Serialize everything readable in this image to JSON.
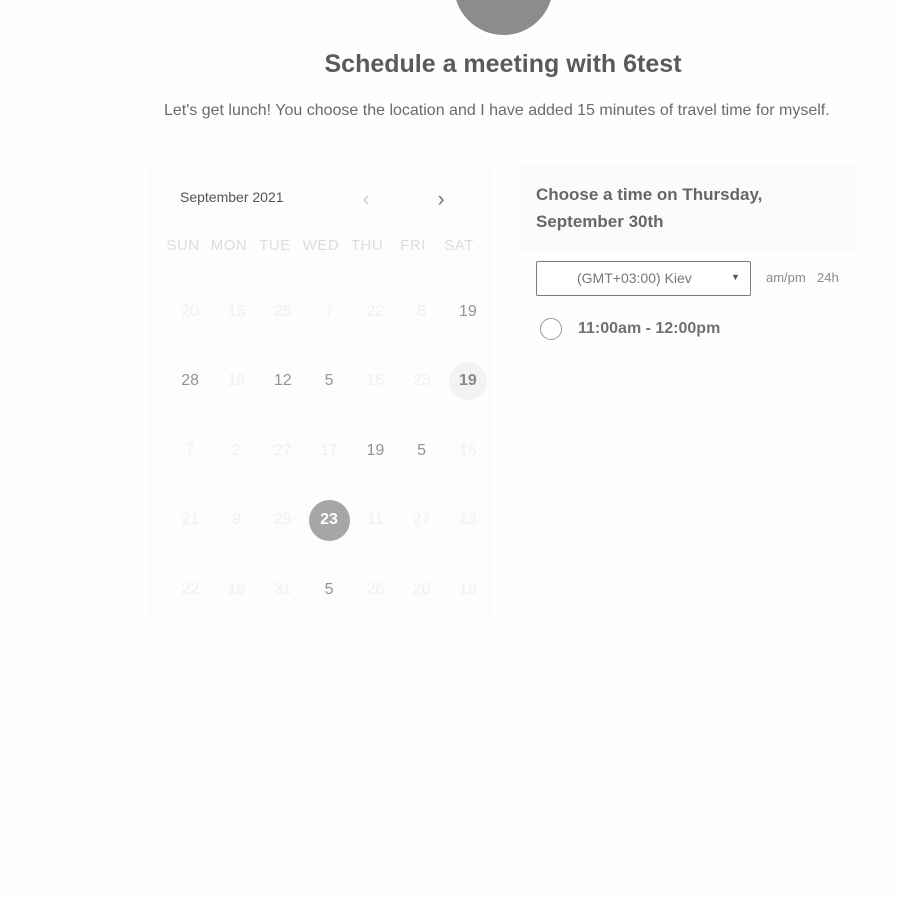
{
  "header": {
    "title": "Schedule a meeting with 6test",
    "description": "Let's get lunch! You choose the location and I have added 15 minutes of travel time for myself."
  },
  "calendar": {
    "month_label": "September 2021",
    "prev_icon": "chevron-left-icon",
    "next_icon": "chevron-right-icon",
    "weekdays": [
      "SUN",
      "MON",
      "TUE",
      "WED",
      "THU",
      "FRI",
      "SAT"
    ],
    "days": [
      {
        "label": "20",
        "state": "faded"
      },
      {
        "label": "15",
        "state": "faded"
      },
      {
        "label": "25",
        "state": "faded"
      },
      {
        "label": "7",
        "state": "faded"
      },
      {
        "label": "22",
        "state": "faded"
      },
      {
        "label": "8",
        "state": "faded"
      },
      {
        "label": "19",
        "state": "available"
      },
      {
        "label": "28",
        "state": "available"
      },
      {
        "label": "18",
        "state": "faded"
      },
      {
        "label": "12",
        "state": "available"
      },
      {
        "label": "5",
        "state": "available"
      },
      {
        "label": "16",
        "state": "faded"
      },
      {
        "label": "25",
        "state": "faded"
      },
      {
        "label": "19",
        "state": "circled"
      },
      {
        "label": "7",
        "state": "faded"
      },
      {
        "label": "2",
        "state": "faded"
      },
      {
        "label": "27",
        "state": "faded"
      },
      {
        "label": "17",
        "state": "faded"
      },
      {
        "label": "19",
        "state": "available"
      },
      {
        "label": "5",
        "state": "available"
      },
      {
        "label": "16",
        "state": "faded"
      },
      {
        "label": "21",
        "state": "faded"
      },
      {
        "label": "9",
        "state": "faded"
      },
      {
        "label": "29",
        "state": "faded"
      },
      {
        "label": "23",
        "state": "selected"
      },
      {
        "label": "11",
        "state": "faded"
      },
      {
        "label": "27",
        "state": "faded"
      },
      {
        "label": "13",
        "state": "faded"
      },
      {
        "label": "22",
        "state": "faded"
      },
      {
        "label": "16",
        "state": "faded"
      },
      {
        "label": "31",
        "state": "faded"
      },
      {
        "label": "5",
        "state": "available"
      },
      {
        "label": "26",
        "state": "faded"
      },
      {
        "label": "20",
        "state": "faded"
      },
      {
        "label": "19",
        "state": "faded"
      }
    ]
  },
  "times": {
    "title": "Choose a time on Thursday, September 30th",
    "timezone": "(GMT+03:00) Kiev",
    "timezone_icon": "caret-down-icon",
    "format_12h": "am/pm",
    "format_24h": "24h",
    "slots": [
      "11:00am - 12:00pm"
    ]
  },
  "colors": {
    "selected_day": "#a6a6a6",
    "available_text": "#939393",
    "background": "#fefefe"
  }
}
